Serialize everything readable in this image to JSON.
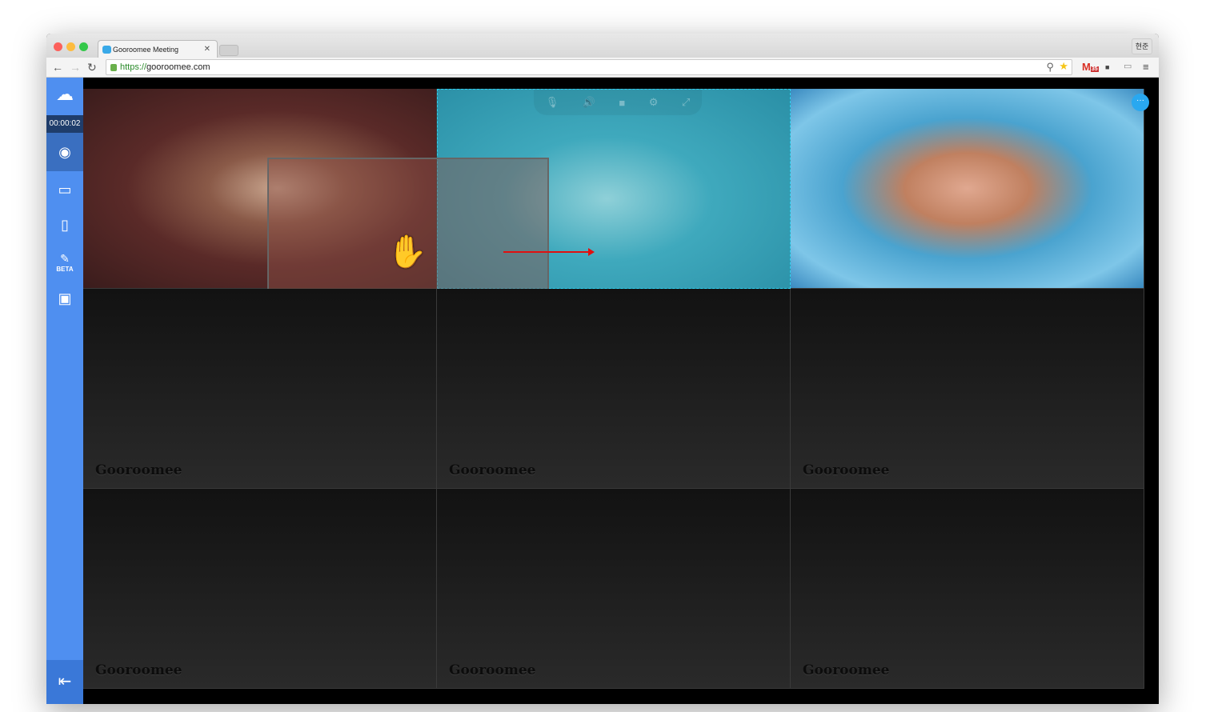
{
  "browser": {
    "tab_title": "Gooroomee Meeting",
    "url_scheme": "https://",
    "url_host": "gooroomee.com",
    "user_button": "현준",
    "gmail_badge": "35"
  },
  "sidebar": {
    "timer": "00:00:02",
    "beta_label": "BETA"
  },
  "tiles": [
    {
      "label": "Gooroomee"
    },
    {
      "label": "Gooroomee"
    },
    {
      "label": "Gooroomee"
    },
    {
      "label": "Gooroomee"
    },
    {
      "label": "Gooroomee"
    },
    {
      "label": "Gooroomee"
    }
  ],
  "chat_icon": "···"
}
